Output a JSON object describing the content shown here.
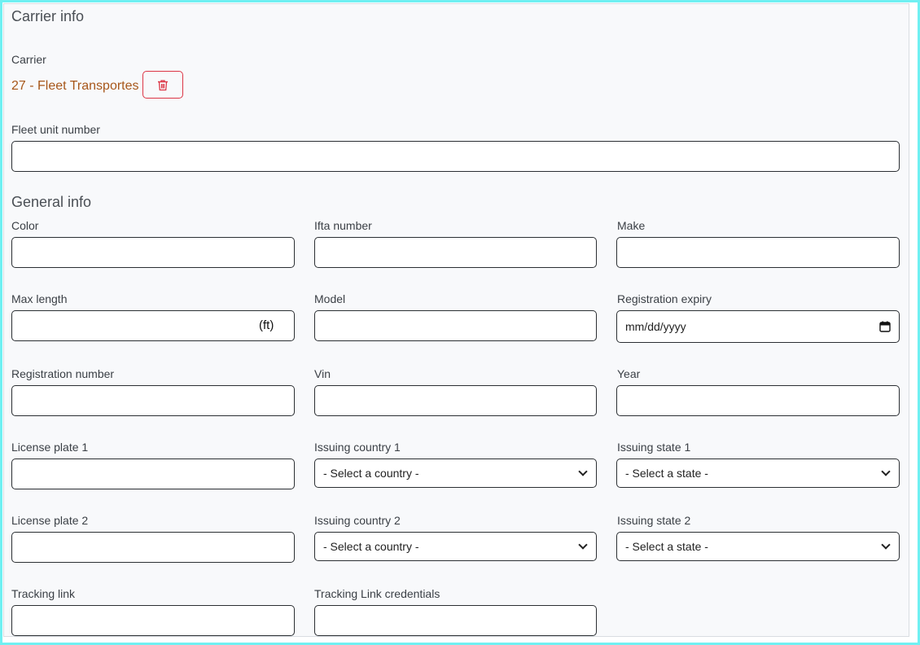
{
  "carrier_info": {
    "section_title": "Carrier info",
    "carrier_label": "Carrier",
    "carrier_value": "27 - Fleet Transportes",
    "fleet_unit_label": "Fleet unit number",
    "fleet_unit_value": ""
  },
  "general_info": {
    "section_title": "General info",
    "color": {
      "label": "Color",
      "value": ""
    },
    "ifta_number": {
      "label": "Ifta number",
      "value": ""
    },
    "make": {
      "label": "Make",
      "value": ""
    },
    "max_length": {
      "label": "Max length",
      "value": "",
      "unit": "(ft)"
    },
    "model": {
      "label": "Model",
      "value": ""
    },
    "registration_expiry": {
      "label": "Registration expiry",
      "placeholder": "mm/dd/yyyy"
    },
    "registration_number": {
      "label": "Registration number",
      "value": ""
    },
    "vin": {
      "label": "Vin",
      "value": ""
    },
    "year": {
      "label": "Year",
      "value": ""
    },
    "license_plate_1": {
      "label": "License plate 1",
      "value": ""
    },
    "issuing_country_1": {
      "label": "Issuing country 1",
      "selected": "- Select a country -"
    },
    "issuing_state_1": {
      "label": "Issuing state 1",
      "selected": "- Select a state -"
    },
    "license_plate_2": {
      "label": "License plate 2",
      "value": ""
    },
    "issuing_country_2": {
      "label": "Issuing country 2",
      "selected": "- Select a country -"
    },
    "issuing_state_2": {
      "label": "Issuing state 2",
      "selected": "- Select a state -"
    },
    "tracking_link": {
      "label": "Tracking link",
      "value": ""
    },
    "tracking_link_credentials": {
      "label": "Tracking Link credentials",
      "value": ""
    }
  },
  "colors": {
    "frame_border": "#6ff0f2",
    "carrier_link": "#a7571a",
    "danger": "#dc3545"
  },
  "icons": {
    "delete": "trash-icon",
    "calendar": "calendar-icon",
    "dropdown": "chevron-down-icon"
  }
}
